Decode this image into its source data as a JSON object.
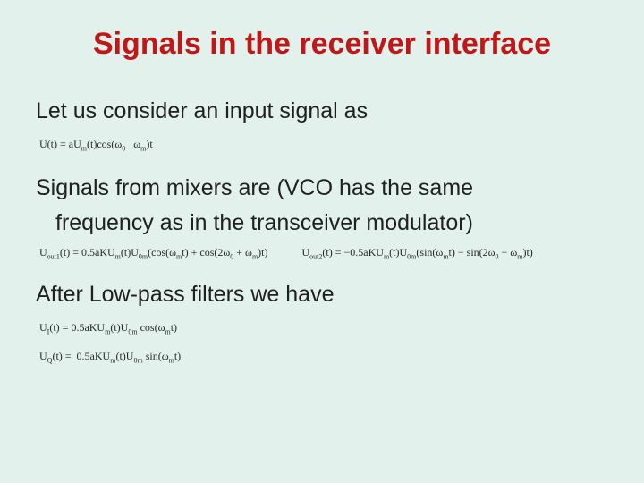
{
  "title": "Signals in the receiver interface",
  "line1": "Let us consider an input signal as",
  "eq1_html": "U(t) = aU<span class='sub'>m</span>(t)cos(ω<span class='sub'>0</span> &nbsp; ω<span class='sub'>m</span>)t",
  "line2a": "Signals from mixers are (VCO has the same",
  "line2b": "frequency as in the transceiver  modulator)",
  "eq2a_html": "U<span class='sub'>out1</span>(t) = 0.5aKU<span class='sub'>m</span>(t)U<span class='sub'>0m</span>(cos(ω<span class='sub'>m</span>t) + cos(2ω<span class='sub'>0</span> + ω<span class='sub'>m</span>)t)",
  "eq2b_html": "U<span class='sub'>out2</span>(t) = −0.5aKU<span class='sub'>m</span>(t)U<span class='sub'>0m</span>(sin(ω<span class='sub'>m</span>t) − sin(2ω<span class='sub'>0</span> − ω<span class='sub'>m</span>)t)",
  "line3": "After Low-pass filters we have",
  "eq3a_html": "U<span class='sub'>I</span>(t) = 0.5aKU<span class='sub'>m</span>(t)U<span class='sub'>0m</span> cos(ω<span class='sub'>m</span>t)",
  "eq3b_html": "U<span class='sub'>Q</span>(t) = &nbsp;0.5aKU<span class='sub'>m</span>(t)U<span class='sub'>0m</span> sin(ω<span class='sub'>m</span>t)"
}
